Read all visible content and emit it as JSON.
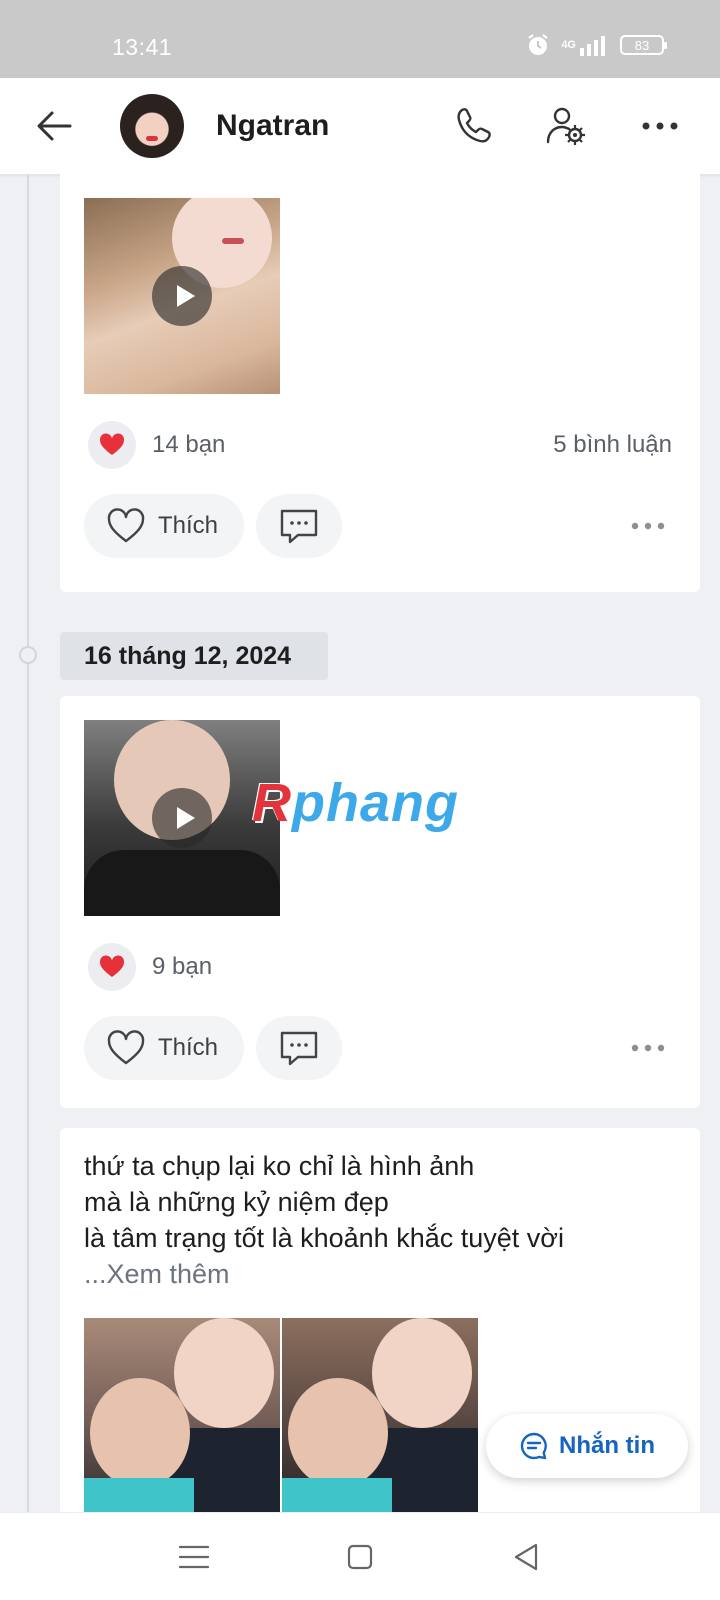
{
  "status_bar": {
    "time": "13:41",
    "network": "4G",
    "battery": "83"
  },
  "header": {
    "name": "Ngatran"
  },
  "posts": [
    {
      "reactions": "14 bạn",
      "comments": "5 bình luận",
      "like_label": "Thích"
    },
    {
      "date": "16 tháng 12, 2024",
      "reactions": "9 bạn",
      "like_label": "Thích"
    },
    {
      "text_lines": [
        "thứ ta chụp lại ko chỉ là hình ảnh",
        "mà là những kỷ niệm đẹp",
        "là tâm trạng tốt là khoảnh khắc tuyệt vời"
      ],
      "see_more": "...Xem thêm"
    }
  ],
  "watermark": {
    "first_letter": "R",
    "rest": "phang"
  },
  "fab": {
    "label": "Nhắn tin"
  },
  "colors": {
    "accent": "#1565c0",
    "heart": "#e8303a",
    "background": "#eef0f3"
  }
}
